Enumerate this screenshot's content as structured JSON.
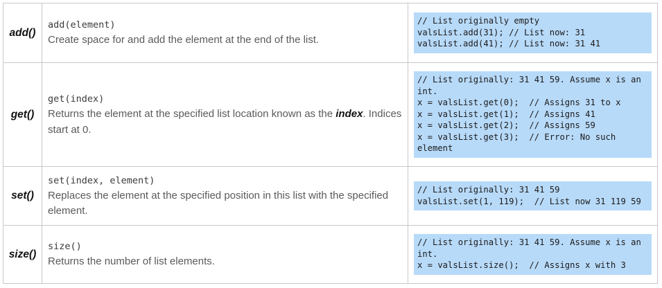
{
  "rows": [
    {
      "name": "add()",
      "signature": "add(element)",
      "description": "Create space for and add the element at the end of the list.",
      "example": "// List originally empty\nvalsList.add(31); // List now: 31\nvalsList.add(41); // List now: 31 41"
    },
    {
      "name": "get()",
      "signature": "get(index)",
      "description_before": "Returns the element at the specified list location known as the ",
      "description_emphasis": "index",
      "description_after": ". Indices start at 0.",
      "example": "// List originally: 31 41 59. Assume x is an int.\nx = valsList.get(0);  // Assigns 31 to x\nx = valsList.get(1);  // Assigns 41\nx = valsList.get(2);  // Assigns 59\nx = valsList.get(3);  // Error: No such element"
    },
    {
      "name": "set()",
      "signature": "set(index, element)",
      "description": "Replaces the element at the specified position in this list with the specified element.",
      "example": "// List originally: 31 41 59\nvalsList.set(1, 119);  // List now 31 119 59"
    },
    {
      "name": "size()",
      "signature": "size()",
      "description": "Returns the number of list elements.",
      "example": "// List originally: 31 41 59. Assume x is an int.\nx = valsList.size();  // Assigns x with 3"
    }
  ]
}
